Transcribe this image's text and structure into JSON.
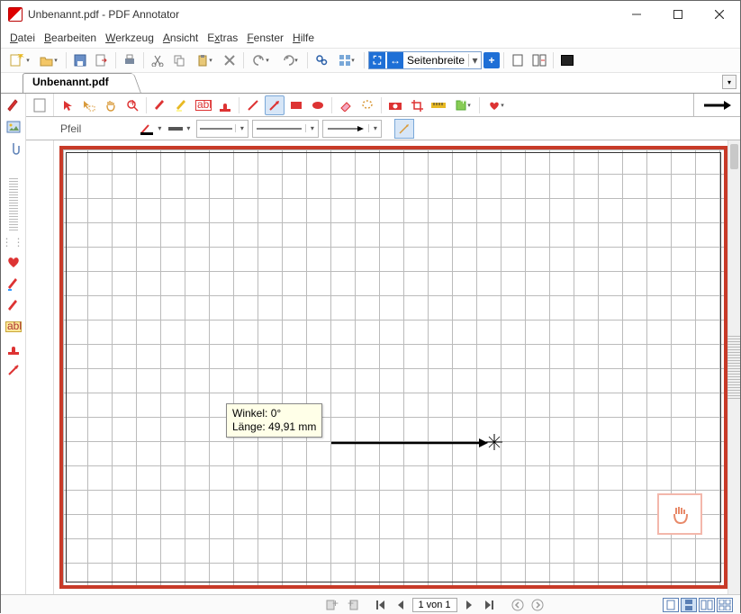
{
  "window": {
    "title": "Unbenannt.pdf - PDF Annotator"
  },
  "menu": {
    "file": "Datei",
    "edit": "Bearbeiten",
    "tool": "Werkzeug",
    "view": "Ansicht",
    "extras": "Extras",
    "window": "Fenster",
    "help": "Hilfe"
  },
  "toolbar": {
    "zoom_mode": "Seitenbreite"
  },
  "tab": {
    "name": "Unbenannt.pdf"
  },
  "optbar": {
    "tool_name": "Pfeil"
  },
  "tooltip": {
    "angle_label": "Winkel:",
    "angle_value": "0°",
    "length_label": "Länge:",
    "length_value": "49,91 mm"
  },
  "status": {
    "page": "1 von 1"
  }
}
